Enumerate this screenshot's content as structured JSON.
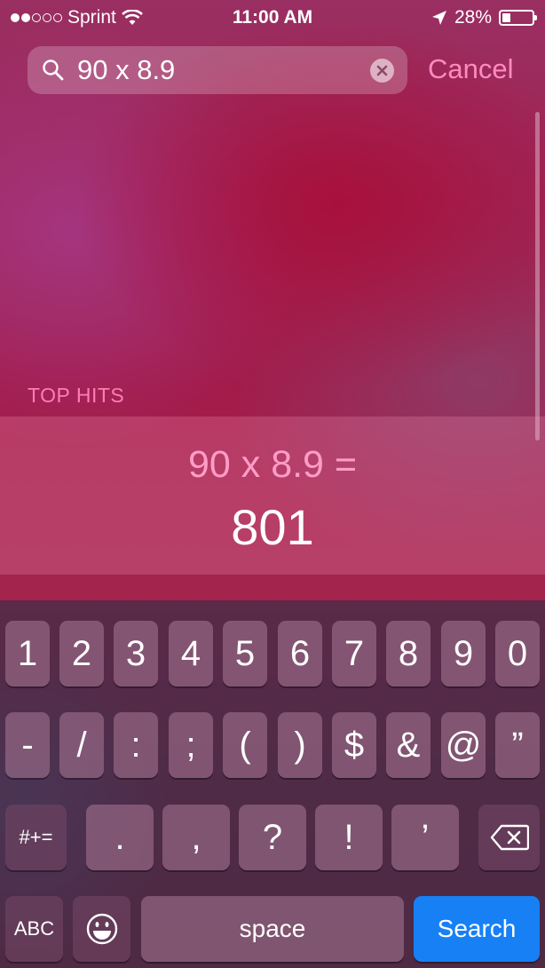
{
  "status_bar": {
    "carrier": "Sprint",
    "time": "11:00 AM",
    "battery_percent": "28%",
    "battery_level": 0.28,
    "signal_bars_filled": 2,
    "signal_bars_total": 5
  },
  "search": {
    "query": "90 x 8.9",
    "cancel_label": "Cancel"
  },
  "results": {
    "section_title": "TOP HITS",
    "calculation": {
      "expression": "90 x 8.9 =",
      "answer": "801"
    }
  },
  "keyboard": {
    "row1": [
      "1",
      "2",
      "3",
      "4",
      "5",
      "6",
      "7",
      "8",
      "9",
      "0"
    ],
    "row2": [
      "-",
      "/",
      ":",
      ";",
      "(",
      ")",
      "$",
      "&",
      "@",
      "”"
    ],
    "row3": {
      "toggle_label": "#+=",
      "keys": [
        ".",
        ",",
        "?",
        "!",
        "’"
      ]
    },
    "row4": {
      "abc_label": "ABC",
      "space_label": "space",
      "search_label": "Search"
    }
  },
  "colors": {
    "accent_pink": "#ff8ac0",
    "search_key_blue": "#1780f5"
  }
}
